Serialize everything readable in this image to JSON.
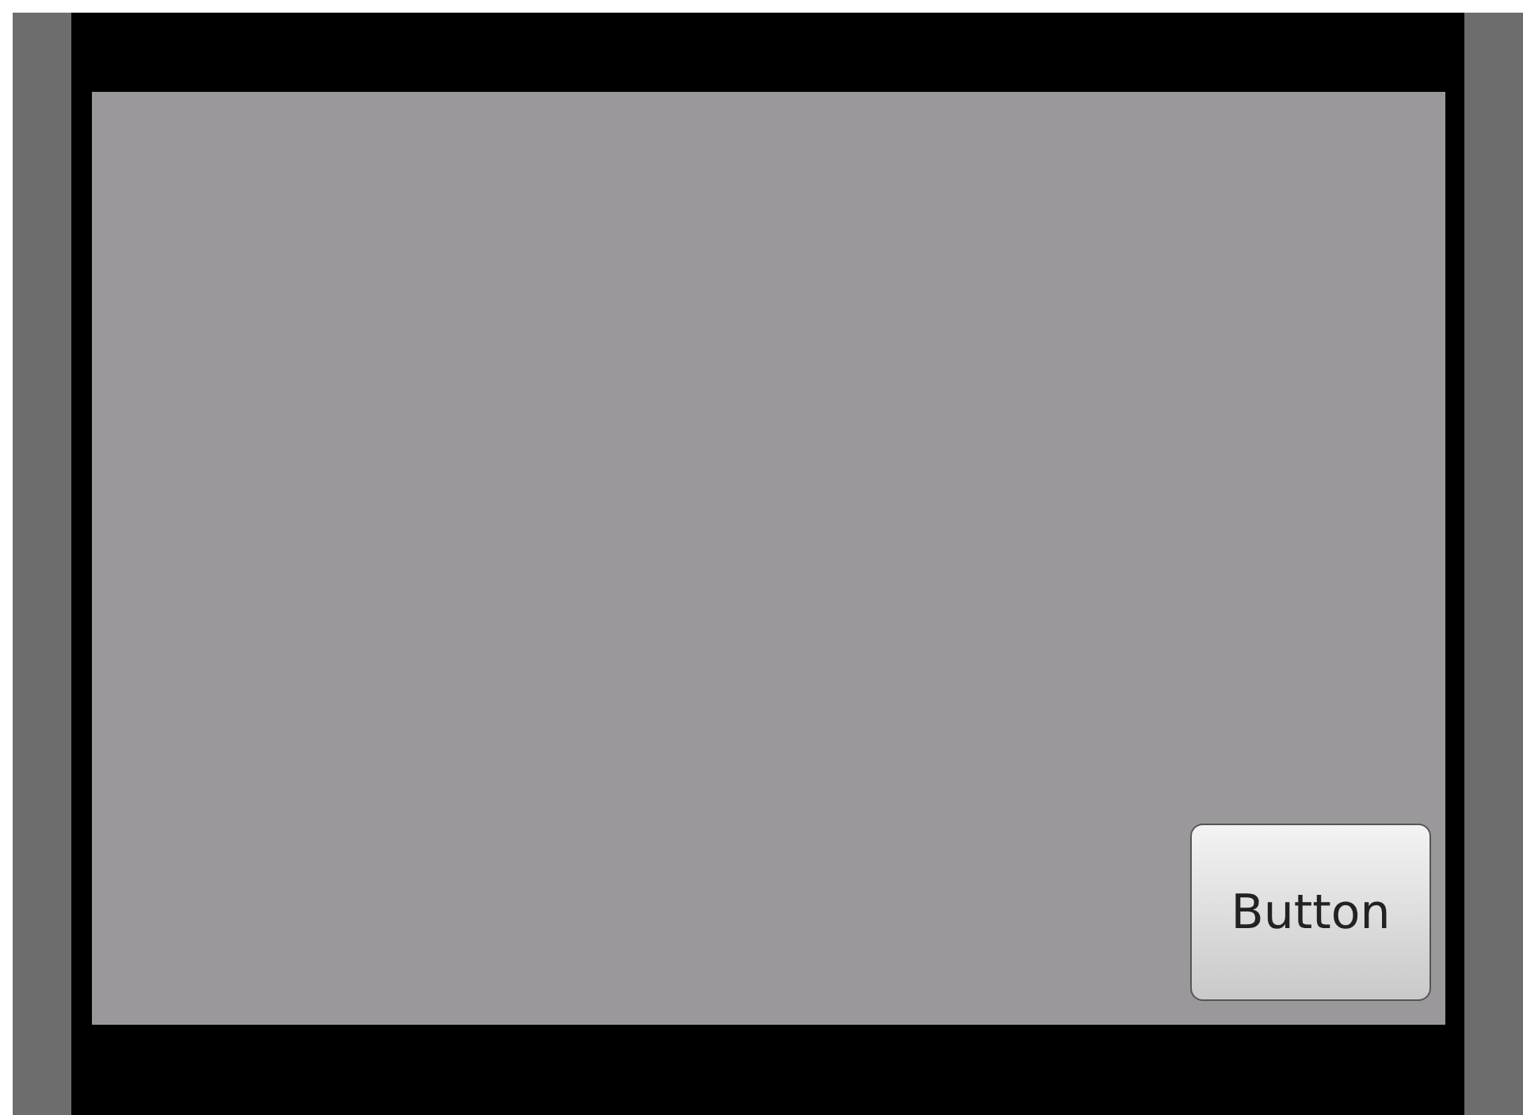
{
  "button": {
    "label": "Button"
  }
}
